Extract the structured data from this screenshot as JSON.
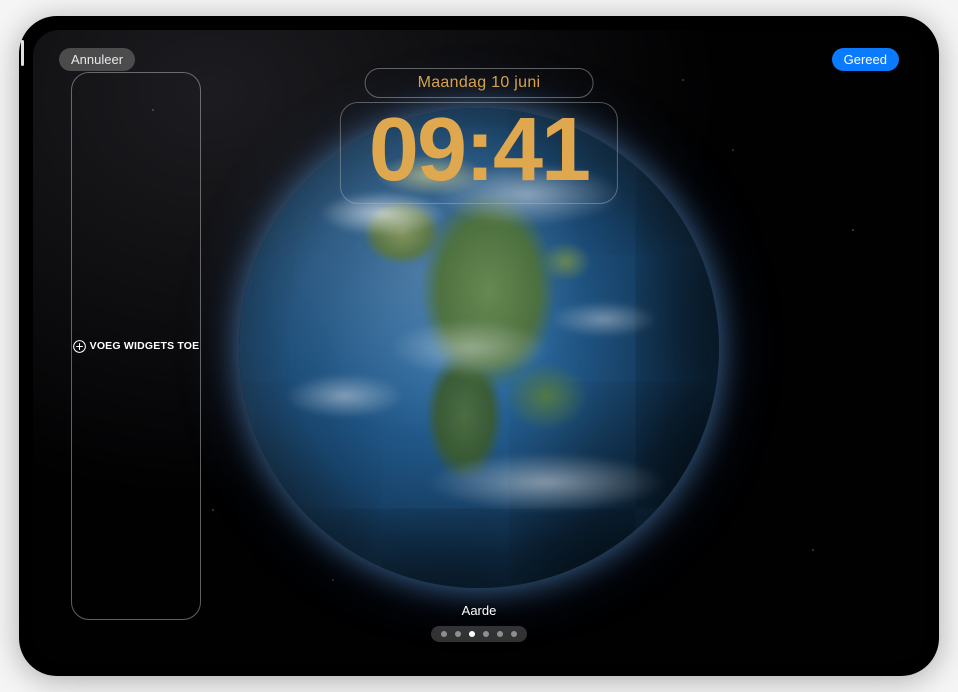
{
  "buttons": {
    "cancel": "Annuleer",
    "done": "Gereed"
  },
  "lockscreen": {
    "date": "Maandag 10 juni",
    "time": "09:41",
    "accent_color": "#e0a84e"
  },
  "widget_panel": {
    "add_label": "VOEG WIDGETS TOE"
  },
  "wallpaper": {
    "label": "Aarde",
    "type": "earth"
  },
  "pager": {
    "count": 6,
    "active_index": 2
  }
}
